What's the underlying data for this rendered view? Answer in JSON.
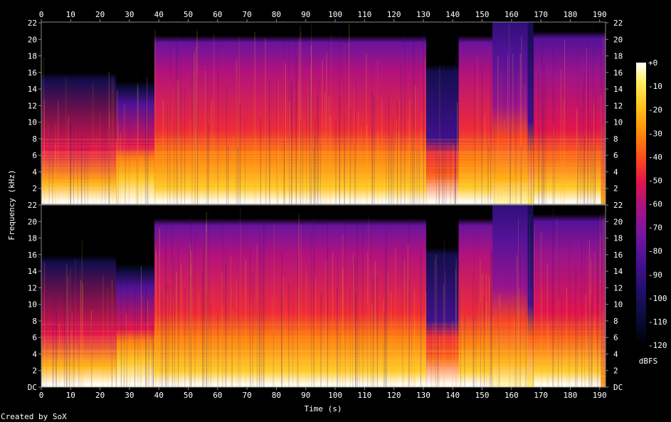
{
  "chart_data": {
    "type": "heatmap",
    "xlabel": "Time (s)",
    "ylabel": "Frequency (kHz)",
    "xlim": [
      0,
      192
    ],
    "ylim": [
      0,
      22
    ],
    "x_ticks": [
      "0",
      "10",
      "20",
      "30",
      "40",
      "50",
      "60",
      "70",
      "80",
      "90",
      "100",
      "110",
      "120",
      "130",
      "140",
      "150",
      "160",
      "170",
      "180",
      "190"
    ],
    "y_ticks": [
      "DC",
      "2",
      "4",
      "6",
      "8",
      "10",
      "12",
      "14",
      "16",
      "18",
      "20",
      "22"
    ],
    "channels": 2,
    "colorbar": {
      "label": "dBFS",
      "range_db": [
        -120,
        0
      ],
      "ticks": [
        "+0",
        "-10",
        "-20",
        "-30",
        "-40",
        "-50",
        "-60",
        "-70",
        "-80",
        "-90",
        "-100",
        "-110",
        "-120"
      ]
    },
    "footer": "Created by SoX",
    "segments": [
      {
        "t0": 0,
        "t1": 25.5,
        "bands_khz": [
          [
            0.3,
            0
          ],
          [
            2.5,
            -25
          ],
          [
            6.5,
            -55
          ],
          [
            15,
            -105
          ]
        ]
      },
      {
        "t0": 25.5,
        "t1": 38.5,
        "bands_khz": [
          [
            0.3,
            0
          ],
          [
            3,
            -20
          ],
          [
            5.5,
            -35
          ],
          [
            7,
            -55
          ],
          [
            12,
            -85
          ],
          [
            14,
            -108
          ]
        ]
      },
      {
        "t0": 38.5,
        "t1": 131,
        "bands_khz": [
          [
            0.3,
            0
          ],
          [
            2,
            -20
          ],
          [
            6,
            -35
          ],
          [
            9,
            -50
          ],
          [
            16,
            -65
          ],
          [
            19.5,
            -80
          ]
        ]
      },
      {
        "t0": 131,
        "t1": 142,
        "bands_khz": [
          [
            0.3,
            0
          ],
          [
            3.5,
            -40
          ],
          [
            6,
            -50
          ],
          [
            8,
            -90
          ],
          [
            16,
            -105
          ]
        ]
      },
      {
        "t0": 142,
        "t1": 153.5,
        "bands_khz": [
          [
            0.3,
            0
          ],
          [
            2,
            -20
          ],
          [
            5.5,
            -35
          ],
          [
            9,
            -50
          ],
          [
            16,
            -65
          ],
          [
            19.5,
            -80
          ]
        ]
      },
      {
        "t0": 153.5,
        "t1": 165.5,
        "bands_khz": [
          [
            0.3,
            -5
          ],
          [
            3,
            -25
          ],
          [
            8,
            -45
          ],
          [
            12,
            -70
          ],
          [
            18,
            -85
          ],
          [
            22,
            -95
          ]
        ]
      },
      {
        "t0": 165.5,
        "t1": 167.5,
        "bands_khz": [
          [
            0.3,
            -10
          ],
          [
            6,
            -40
          ],
          [
            10,
            -90
          ],
          [
            22,
            -105
          ]
        ]
      },
      {
        "t0": 167.5,
        "t1": 190.5,
        "bands_khz": [
          [
            0.3,
            0
          ],
          [
            2,
            -20
          ],
          [
            6,
            -40
          ],
          [
            9,
            -55
          ],
          [
            16,
            -70
          ],
          [
            20,
            -85
          ]
        ]
      },
      {
        "t0": 190.5,
        "t1": 192,
        "bands_khz": [
          [
            0.3,
            -30
          ],
          [
            10,
            -60
          ],
          [
            20,
            -80
          ]
        ]
      }
    ],
    "colors": {
      "background": "#000000",
      "palette": [
        "#000000",
        "#0a0d3a",
        "#230f6e",
        "#4a1196",
        "#7a16a0",
        "#b0127e",
        "#e4154a",
        "#fb4a1e",
        "#ff8a0a",
        "#ffc218",
        "#ffee60",
        "#ffffff"
      ]
    }
  }
}
